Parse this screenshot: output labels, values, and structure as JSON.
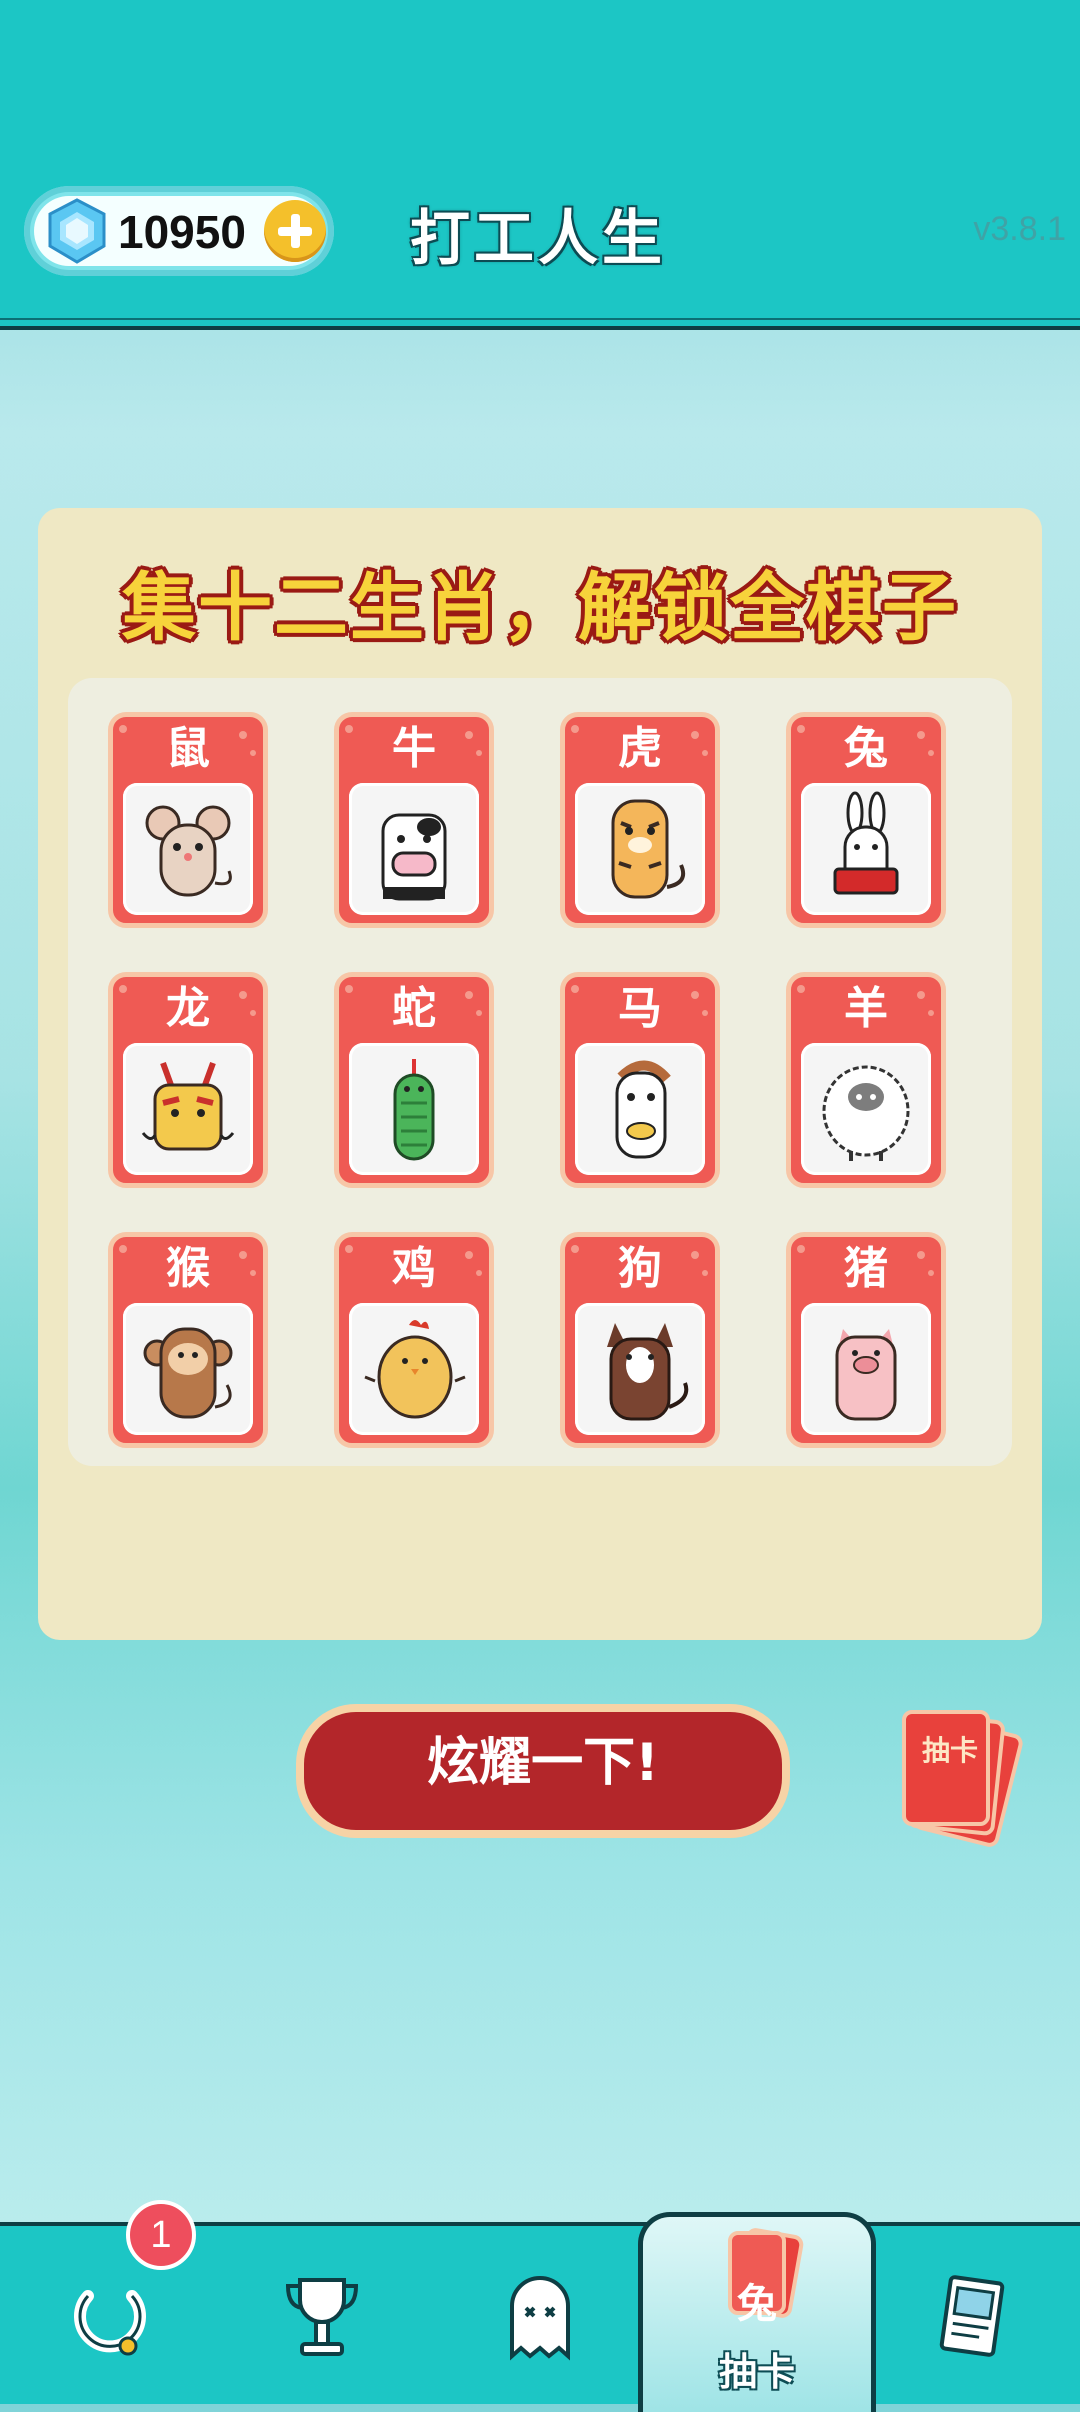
{
  "header": {
    "gems": "10950",
    "title": "打工人生",
    "version": "v3.8.1"
  },
  "panel": {
    "title": "集十二生肖，解锁全棋子",
    "zodiac": [
      {
        "name": "鼠",
        "icon": "rat-icon"
      },
      {
        "name": "牛",
        "icon": "cow-icon"
      },
      {
        "name": "虎",
        "icon": "tiger-icon"
      },
      {
        "name": "兔",
        "icon": "rabbit-icon"
      },
      {
        "name": "龙",
        "icon": "dragon-icon"
      },
      {
        "name": "蛇",
        "icon": "snake-icon"
      },
      {
        "name": "马",
        "icon": "horse-icon"
      },
      {
        "name": "羊",
        "icon": "sheep-icon"
      },
      {
        "name": "猴",
        "icon": "monkey-icon"
      },
      {
        "name": "鸡",
        "icon": "chicken-icon"
      },
      {
        "name": "狗",
        "icon": "dog-icon"
      },
      {
        "name": "猪",
        "icon": "pig-icon"
      }
    ]
  },
  "actions": {
    "show_off": "炫耀一下!",
    "draw_deck": "抽卡"
  },
  "nav": {
    "badge_count": "1",
    "items": [
      {
        "icon": "spin-icon"
      },
      {
        "icon": "trophy-icon"
      },
      {
        "icon": "ghost-icon"
      },
      {
        "icon": "card-draw-icon",
        "card_label": "兔",
        "label": "抽卡"
      },
      {
        "icon": "book-icon"
      }
    ]
  },
  "colors": {
    "teal": "#1cc6c5",
    "card_red": "#ef5a54",
    "button_red": "#b3262a",
    "panel_cream": "#efe8c4"
  }
}
